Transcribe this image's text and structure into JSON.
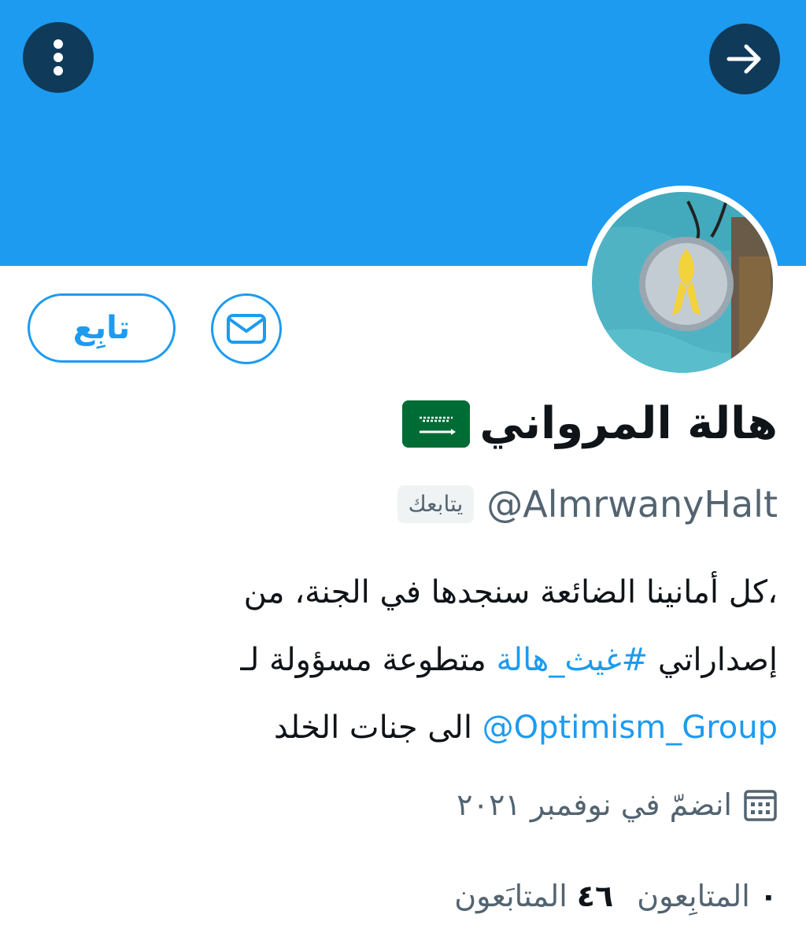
{
  "header": {
    "more_icon": "more-vertical-icon",
    "forward_icon": "arrow-right-icon",
    "banner_color": "#1d9bf0"
  },
  "actions": {
    "follow_label": "تابِع",
    "message_icon": "mail-icon"
  },
  "profile": {
    "display_name": "هالة المرواني",
    "flag_icon": "saudi-flag-icon",
    "handle": "@AlmrwanyHalt",
    "follows_you_badge": "يتابعك",
    "bio": {
      "line1": "،كل أمانينا الضائعة سنجدها في الجنة، من",
      "line2_prefix": "إصداراتي",
      "line2_hashtag": "#غيث_هالة",
      "line2_suffix": "متطوعة مسؤولة لـ",
      "line3_mention": "@Optimism_Group",
      "line3_suffix": "الى جنات الخلد"
    },
    "joined": "انضمّ في نوفمبر ٢٠٢١",
    "calendar_icon": "calendar-icon"
  },
  "stats": {
    "following_count": "٤٦",
    "following_label": "المتابَعون",
    "followers_count": "٠",
    "followers_label": "المتابِعون"
  },
  "colors": {
    "accent": "#1d9bf0",
    "dark_button": "#0f3a5a",
    "text_primary": "#0f1419",
    "text_secondary": "#536471",
    "flag_green": "#006c35"
  }
}
